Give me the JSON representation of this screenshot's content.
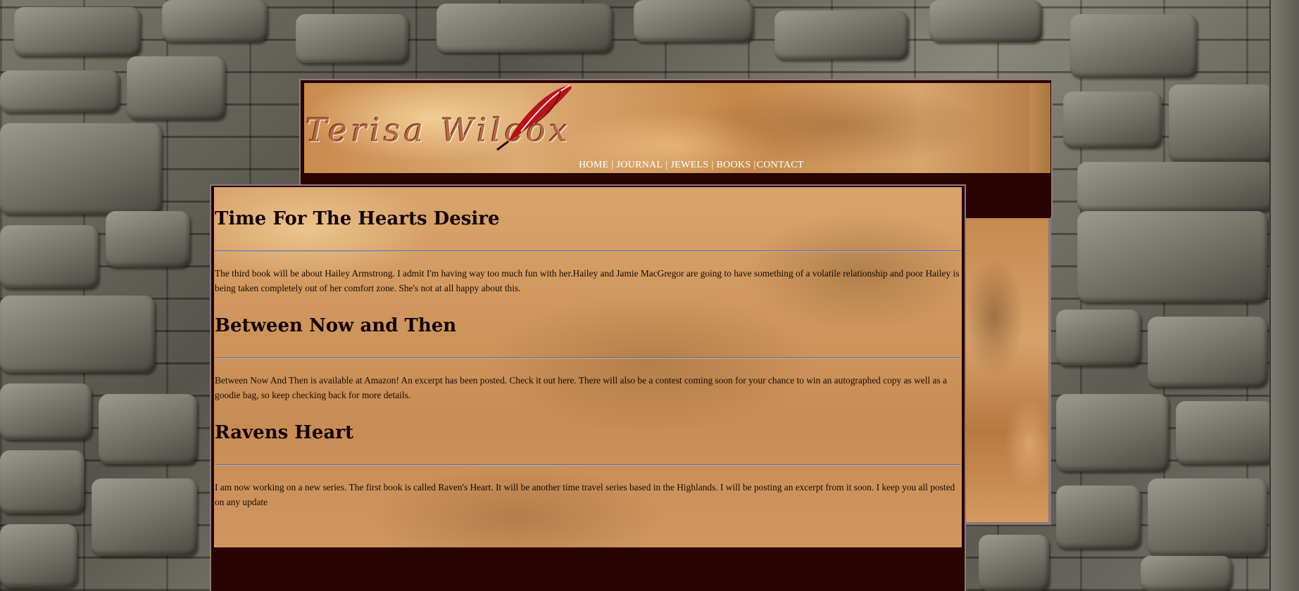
{
  "site": {
    "logo_text": "Terisa Wilcox",
    "nav": [
      {
        "label": "HOME"
      },
      {
        "label": "JOURNAL"
      },
      {
        "label": "JEWELS"
      },
      {
        "label": "BOOKS"
      },
      {
        "label": "CONTACT"
      }
    ]
  },
  "posts": [
    {
      "title": "Time For The Hearts Desire",
      "body": "The third book will be about Hailey Armstrong. I admit I'm having way too much fun with her.Hailey and Jamie MacGregor are going to have something of a volatile relationship and poor Hailey is being taken completely out of her comfort zone. She's not at all happy about this."
    },
    {
      "title": "Between Now and Then",
      "body": "Between Now And Then is available at Amazon! An excerpt has been posted. Check it out here. There will also be a contest coming soon for your chance to win an autographed copy as well as a goodie bag, so keep checking back for more details."
    },
    {
      "title": "Ravens Heart",
      "body": "I am now working on a new series. The first book is called Raven's Heart. It will be another time travel series based in the Highlands. I will be posting an excerpt from it soon. I keep you all posted on any update"
    }
  ],
  "colors": {
    "frame": "#2a0303",
    "border": "#8c7a7a",
    "parchment": "#d9a46c",
    "heading": "#140000"
  },
  "icons": {
    "feather": "quill-feather-icon"
  }
}
